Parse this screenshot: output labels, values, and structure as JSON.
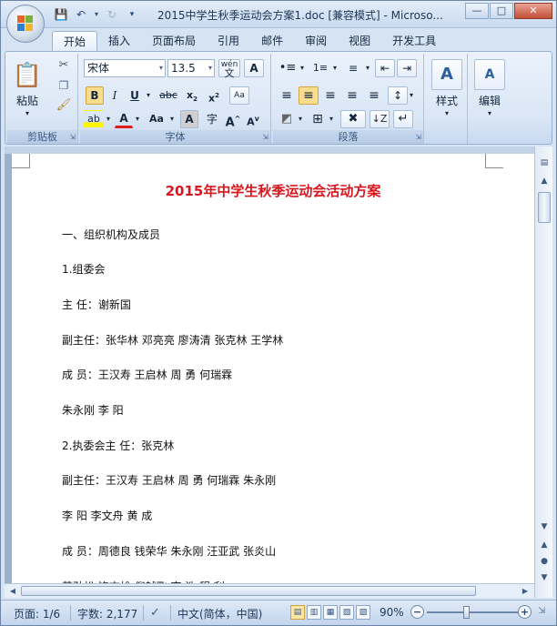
{
  "window": {
    "title": "2015中学生秋季运动会方案1.doc [兼容模式] - Microso..."
  },
  "quick_access": {
    "save_icon": "save-icon",
    "undo_icon": "undo-icon",
    "redo_icon": "redo-icon",
    "customize_icon": "customize-icon"
  },
  "ribbon_tabs": [
    "开始",
    "插入",
    "页面布局",
    "引用",
    "邮件",
    "审阅",
    "视图",
    "开发工具"
  ],
  "ribbon": {
    "clipboard": {
      "group_label": "剪贴板",
      "paste_label": "粘贴"
    },
    "font": {
      "group_label": "字体",
      "font_name": "宋体",
      "font_size": "13.5",
      "phonetic_label": "wén"
    },
    "paragraph": {
      "group_label": "段落"
    },
    "styles": {
      "label": "样式"
    },
    "editing": {
      "label": "编辑"
    }
  },
  "document": {
    "title": "2015年中学生秋季运动会活动方案",
    "paragraphs": [
      "一、组织机构及成员",
      "1.组委会",
      "主 任：谢新国",
      "副主任：张华林 邓亮亮 廖涛清 张克林 王学林",
      "成 员：王汉寿 王启林 周 勇 何瑞霖",
      "朱永刚 李 阳",
      "2.执委会主 任：张克林",
      "副主任：王汉寿 王启林 周 勇 何瑞霖 朱永刚",
      "李 阳 李文舟 黄 成",
      "成 员：周德良 钱荣华 朱永刚 汪亚武 张炎山",
      "莫劲松 饶志雄 倪越飞 李 浩 程 利"
    ]
  },
  "status": {
    "page": "页面: 1/6",
    "words": "字数: 2,177",
    "language": "中文(简体，中国)",
    "zoom": "90%",
    "zoom_level": 90
  },
  "colors": {
    "title_red": "#d8161e",
    "ribbon_blue": "#dbe7f6"
  }
}
